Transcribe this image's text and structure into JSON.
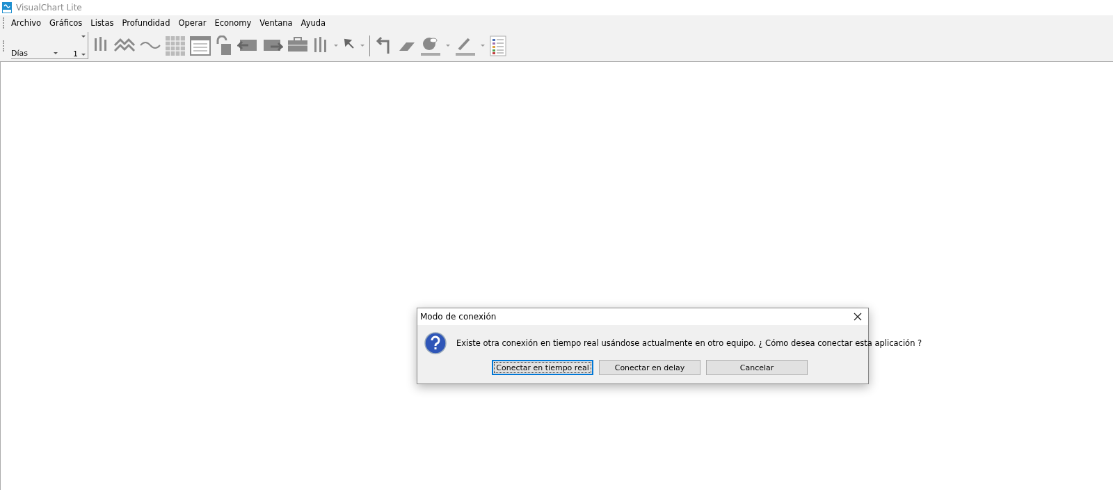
{
  "window": {
    "title": "VisualChart Lite"
  },
  "menu": [
    "Archivo",
    "Gráficos",
    "Listas",
    "Profundidad",
    "Operar",
    "Economy",
    "Ventana",
    "Ayuda"
  ],
  "toolbar": {
    "period": {
      "value": "Días"
    },
    "multiplier": {
      "value": "1"
    }
  },
  "dialog": {
    "title": "Modo de conexión",
    "message": "Existe otra conexión en tiempo real usándose actualmente en otro equipo. ¿ Cómo desea conectar esta aplicación ?",
    "buttons": [
      {
        "label": "Conectar en tiempo real",
        "default": true
      },
      {
        "label": "Conectar en delay",
        "default": false
      },
      {
        "label": "Cancelar",
        "default": false
      }
    ]
  }
}
